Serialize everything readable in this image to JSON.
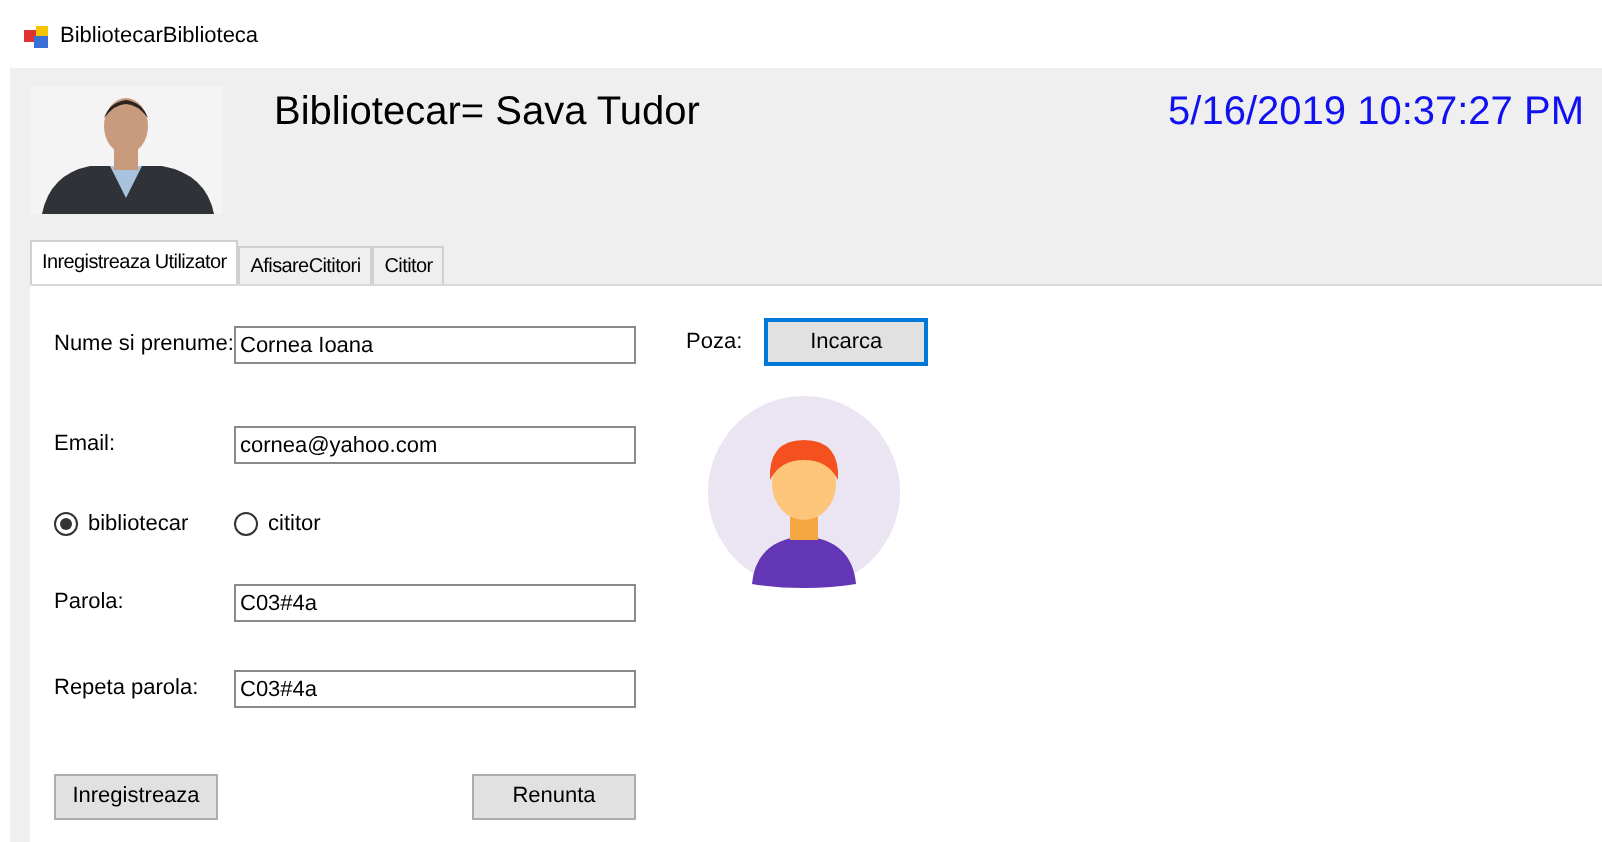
{
  "window": {
    "title": "BibliotecarBiblioteca"
  },
  "header": {
    "name": "Bibliotecar= Sava Tudor",
    "datetime": "5/16/2019 10:37:27 PM"
  },
  "tabs": [
    {
      "label": "Inregistreaza Utilizator",
      "selected": true
    },
    {
      "label": "AfisareCititori",
      "selected": false
    },
    {
      "label": "Cititor",
      "selected": false
    }
  ],
  "form": {
    "fields": [
      {
        "label": "Nume si prenume:",
        "value": "Cornea Ioana"
      },
      {
        "label": "Email:",
        "value": "cornea@yahoo.com"
      }
    ],
    "roles": [
      {
        "label": "bibliotecar",
        "selected": true
      },
      {
        "label": "cititor",
        "selected": false
      }
    ],
    "password_fields": [
      {
        "label": "Parola:",
        "value": "C03#4a"
      },
      {
        "label": "Repeta parola:",
        "value": "C03#4a"
      }
    ],
    "photo_label": "Poza:",
    "upload_button": "Incarca",
    "buttons": [
      "Inregistreaza",
      "Renunta"
    ]
  }
}
